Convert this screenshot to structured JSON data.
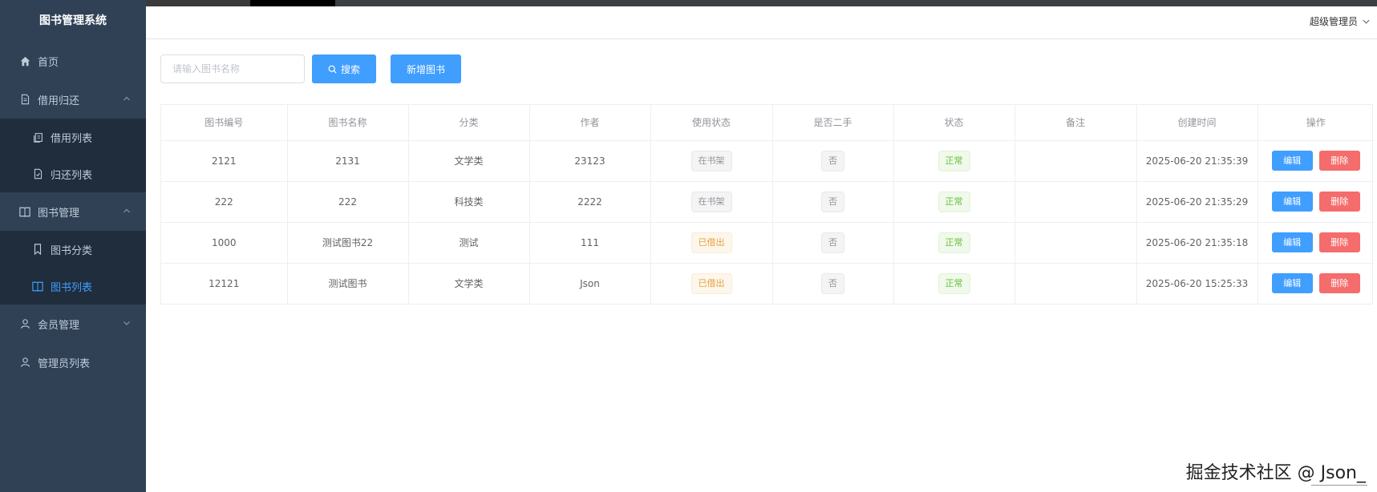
{
  "app": {
    "title": "图书管理系统"
  },
  "header": {
    "user": "超级管理员"
  },
  "sidebar": {
    "items": [
      {
        "label": "首页",
        "icon": "home-icon"
      },
      {
        "label": "借用归还",
        "icon": "document-icon",
        "expanded": true,
        "children": [
          {
            "label": "借用列表",
            "icon": "copy-icon"
          },
          {
            "label": "归还列表",
            "icon": "document-check-icon"
          }
        ]
      },
      {
        "label": "图书管理",
        "icon": "book-icon",
        "expanded": true,
        "children": [
          {
            "label": "图书分类",
            "icon": "bookmark-icon"
          },
          {
            "label": "图书列表",
            "icon": "book-open-icon",
            "active": true
          }
        ]
      },
      {
        "label": "会员管理",
        "icon": "user-icon",
        "expanded": false
      },
      {
        "label": "管理员列表",
        "icon": "user-icon"
      }
    ]
  },
  "toolbar": {
    "search_placeholder": "请输入图书名称",
    "search_value": "",
    "search_label": "搜索",
    "add_label": "新增图书"
  },
  "table": {
    "columns": [
      "图书编号",
      "图书名称",
      "分类",
      "作者",
      "使用状态",
      "是否二手",
      "状态",
      "备注",
      "创建时间",
      "操作"
    ],
    "rows": [
      {
        "id": "2121",
        "name": "2131",
        "category": "文学类",
        "author": "23123",
        "use_status": "在书架",
        "use_type": "info",
        "second_hand": "否",
        "status": "正常",
        "note": "",
        "created": "2025-06-20 21:35:39"
      },
      {
        "id": "222",
        "name": "222",
        "category": "科技类",
        "author": "2222",
        "use_status": "在书架",
        "use_type": "info",
        "second_hand": "否",
        "status": "正常",
        "note": "",
        "created": "2025-06-20 21:35:29"
      },
      {
        "id": "1000",
        "name": "测试图书22",
        "category": "测试",
        "author": "111",
        "use_status": "已借出",
        "use_type": "warning",
        "second_hand": "否",
        "status": "正常",
        "note": "",
        "created": "2025-06-20 21:35:18"
      },
      {
        "id": "12121",
        "name": "测试图书",
        "category": "文学类",
        "author": "Json",
        "use_status": "已借出",
        "use_type": "warning",
        "second_hand": "否",
        "status": "正常",
        "note": "",
        "created": "2025-06-20 15:25:33"
      }
    ],
    "edit_label": "编辑",
    "delete_label": "删除"
  },
  "watermark": "掘金技术社区 @ Json_",
  "colors": {
    "sidebar_bg": "#304156",
    "sidebar_text": "#bfcbd9",
    "accent": "#409eff",
    "danger": "#f56c6c"
  }
}
